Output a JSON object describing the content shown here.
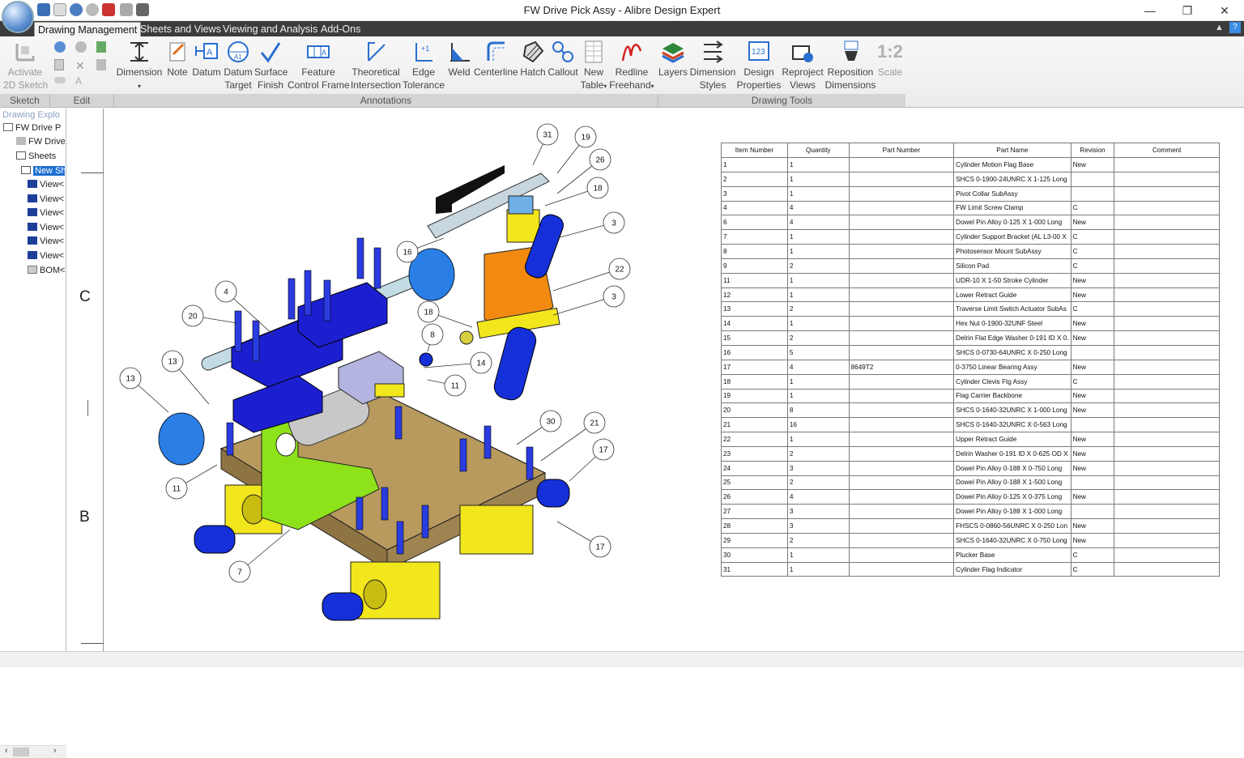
{
  "window": {
    "title": "FW Drive Pick Assy - Alibre Design Expert",
    "minimize": "—",
    "restore": "❐",
    "close": "✕"
  },
  "tabs": [
    "Drawing Management",
    "Sheets and Views",
    "Viewing and Analysis",
    "Add-Ons"
  ],
  "ribbon": {
    "sketch": {
      "line1": "Activate",
      "line2": "2D Sketch"
    },
    "dimension": "Dimension",
    "note": "Note",
    "datum": "Datum",
    "datum_target": {
      "line1": "Datum",
      "line2": "Target"
    },
    "surface_finish": {
      "line1": "Surface",
      "line2": "Finish"
    },
    "feature_control_frame": {
      "line1": "Feature",
      "line2": "Control Frame"
    },
    "theoretical_intersection": {
      "line1": "Theoretical",
      "line2": "Intersection"
    },
    "edge_tolerance": {
      "line1": "Edge",
      "line2": "Tolerance"
    },
    "weld": "Weld",
    "centerline": "Centerline",
    "hatch": "Hatch",
    "callout": "Callout",
    "new_table": {
      "line1": "New",
      "line2": "Table"
    },
    "redline_freehand": {
      "line1": "Redline",
      "line2": "Freehand"
    },
    "layers": "Layers",
    "dimension_styles": {
      "line1": "Dimension",
      "line2": "Styles"
    },
    "design_properties": {
      "line1": "Design",
      "line2": "Properties"
    },
    "reproject_views": {
      "line1": "Reproject",
      "line2": "Views"
    },
    "reposition_dimensions": {
      "line1": "Reposition",
      "line2": "Dimensions"
    },
    "scale": "Scale",
    "scale_icon_text": "1:2",
    "groups": [
      "Sketch",
      "Edit",
      "Annotations",
      "Drawing Tools"
    ]
  },
  "explorer": {
    "title": "Drawing Explo",
    "items": [
      "FW Drive P",
      "FW Drive",
      "Sheets",
      "New Sh",
      "View<",
      "View<",
      "View<",
      "View<",
      "View<",
      "View<",
      "BOM<"
    ]
  },
  "zones": {
    "c": "C",
    "b": "B"
  },
  "balloons": [
    "31",
    "19",
    "26",
    "18",
    "3",
    "16",
    "22",
    "3",
    "4",
    "20",
    "18",
    "8",
    "14",
    "11",
    "13",
    "13",
    "30",
    "21",
    "17",
    "11",
    "17",
    "7"
  ],
  "bom": {
    "headers": [
      "Item Number",
      "Quantity",
      "Part Number",
      "Part Name",
      "Revision",
      "Comment"
    ],
    "rows": [
      [
        "1",
        "1",
        "",
        "Cylinder Motion Flag Base",
        "New",
        ""
      ],
      [
        "2",
        "1",
        "",
        "SHCS 0-1900-24UNRC X 1-125 Long",
        "",
        ""
      ],
      [
        "3",
        "1",
        "",
        "Pivot Collar SubAssy",
        "",
        ""
      ],
      [
        "4",
        "4",
        "",
        "FW Limit Screw Clamp",
        "C",
        ""
      ],
      [
        "6",
        "4",
        "",
        "Dowel Pin Alloy 0-125 X 1-000 Long",
        "New",
        ""
      ],
      [
        "7",
        "1",
        "",
        "Cylinder Support Bracket (AL  L3-00 X",
        "C",
        ""
      ],
      [
        "8",
        "1",
        "",
        "Photosensor Mount SubAssy",
        "C",
        ""
      ],
      [
        "9",
        "2",
        "",
        "Silicon Pad",
        "C",
        ""
      ],
      [
        "11",
        "1",
        "",
        "UDR-10 X 1-50 Stroke Cylinder",
        "New",
        ""
      ],
      [
        "12",
        "1",
        "",
        "Lower Retract Guide",
        "New",
        ""
      ],
      [
        "13",
        "2",
        "",
        "Traverse Limit Switch Actuator SubAs",
        "C",
        ""
      ],
      [
        "14",
        "1",
        "",
        "Hex Nut 0-1900-32UNF Steel",
        "New",
        ""
      ],
      [
        "15",
        "2",
        "",
        "Delrin Flat Edge Washer 0-191 ID X 0.",
        "New",
        ""
      ],
      [
        "16",
        "5",
        "",
        "SHCS 0-0730-64UNRC X 0-250 Long",
        "",
        ""
      ],
      [
        "17",
        "4",
        "8649T2",
        "0-3750 Linear Bearing Assy",
        "New",
        ""
      ],
      [
        "18",
        "1",
        "",
        "Cylinder Clevis Ftg Assy",
        "C",
        ""
      ],
      [
        "19",
        "1",
        "",
        "Flag Carrier Backbone",
        "New",
        ""
      ],
      [
        "20",
        "8",
        "",
        "SHCS 0-1640-32UNRC X 1-000 Long",
        "New",
        ""
      ],
      [
        "21",
        "16",
        "",
        "SHCS 0-1640-32UNRC X 0-563 Long",
        "",
        ""
      ],
      [
        "22",
        "1",
        "",
        "Upper Retract Guide",
        "New",
        ""
      ],
      [
        "23",
        "2",
        "",
        "Delrin Washer 0-191 ID X 0-625 OD X",
        "New",
        ""
      ],
      [
        "24",
        "3",
        "",
        "Dowel Pin Alloy 0-188 X 0-750 Long",
        "New",
        ""
      ],
      [
        "25",
        "2",
        "",
        "Dowel Pin Alloy 0-188 X 1-500 Long",
        "",
        ""
      ],
      [
        "26",
        "4",
        "",
        "Dowel Pin Alloy 0-125 X 0-375 Long",
        "New",
        ""
      ],
      [
        "27",
        "3",
        "",
        "Dowel Pin Alloy 0-188 X 1-000 Long",
        "",
        ""
      ],
      [
        "28",
        "3",
        "",
        "FHSCS 0-0860-56UNRC X 0-250 Lon",
        "New",
        ""
      ],
      [
        "29",
        "2",
        "",
        "SHCS 0-1640-32UNRC X 0-750 Long",
        "New",
        ""
      ],
      [
        "30",
        "1",
        "",
        "Plucker Base",
        "C",
        ""
      ],
      [
        "31",
        "1",
        "",
        "Cylinder Flag Indicator",
        "C",
        ""
      ]
    ]
  }
}
